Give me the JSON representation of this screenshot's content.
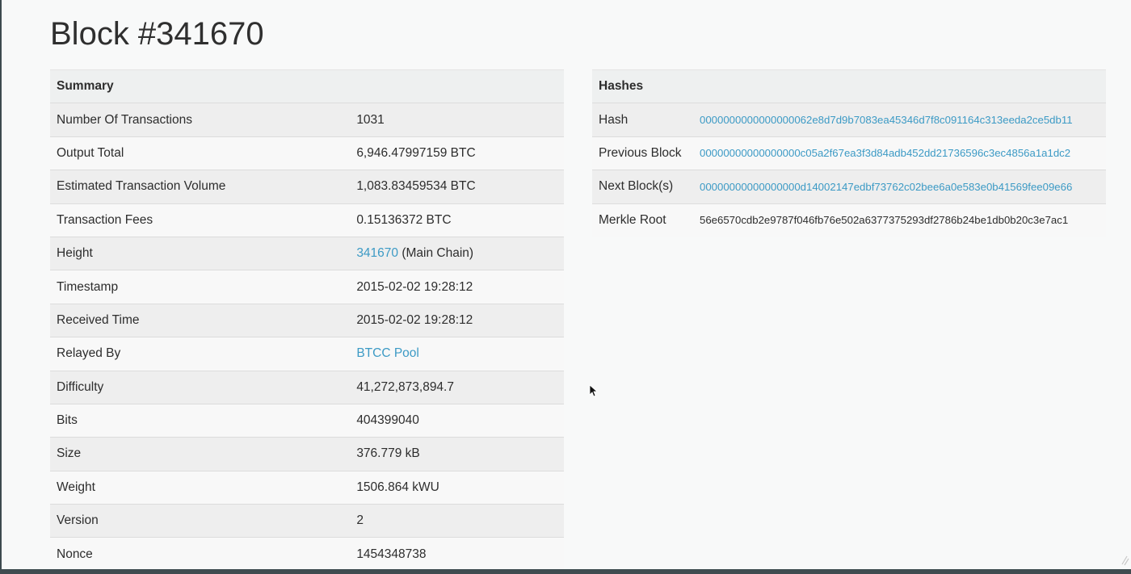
{
  "page_title": "Block #341670",
  "summary": {
    "header": "Summary",
    "rows": [
      {
        "label": "Number Of Transactions",
        "value": "1031"
      },
      {
        "label": "Output Total",
        "value": "6,946.47997159 BTC"
      },
      {
        "label": "Estimated Transaction Volume",
        "value": "1,083.83459534 BTC"
      },
      {
        "label": "Transaction Fees",
        "value": "0.15136372 BTC"
      },
      {
        "label": "Height",
        "value": "341670",
        "suffix": " (Main Chain)"
      },
      {
        "label": "Timestamp",
        "value": "2015-02-02 19:28:12"
      },
      {
        "label": "Received Time",
        "value": "2015-02-02 19:28:12"
      },
      {
        "label": "Relayed By",
        "value": "BTCC Pool"
      },
      {
        "label": "Difficulty",
        "value": "41,272,873,894.7"
      },
      {
        "label": "Bits",
        "value": "404399040"
      },
      {
        "label": "Size",
        "value": "376.779 kB"
      },
      {
        "label": "Weight",
        "value": "1506.864 kWU"
      },
      {
        "label": "Version",
        "value": "2"
      },
      {
        "label": "Nonce",
        "value": "1454348738"
      }
    ]
  },
  "hashes": {
    "header": "Hashes",
    "rows": [
      {
        "label": "Hash",
        "value": "0000000000000000062e8d7d9b7083ea45346d7f8c091164c313eeda2ce5db11"
      },
      {
        "label": "Previous Block",
        "value": "00000000000000000c05a2f67ea3f3d84adb452dd21736596c3ec4856a1a1dc2"
      },
      {
        "label": "Next Block(s)",
        "value": "00000000000000000d14002147edbf73762c02bee6a0e583e0b41569fee09e66"
      },
      {
        "label": "Merkle Root",
        "value": "56e6570cdb2e9787f046fb76e502a6377375293df2786b24be1db0b20c3e7ac1"
      }
    ]
  },
  "colors": {
    "link": "#3c9ac5",
    "text": "#2d2d2d",
    "header_bg": "#eef0f0"
  },
  "icons": {
    "cursor": "mouse-pointer-icon",
    "corner": "resize-grip-icon"
  }
}
